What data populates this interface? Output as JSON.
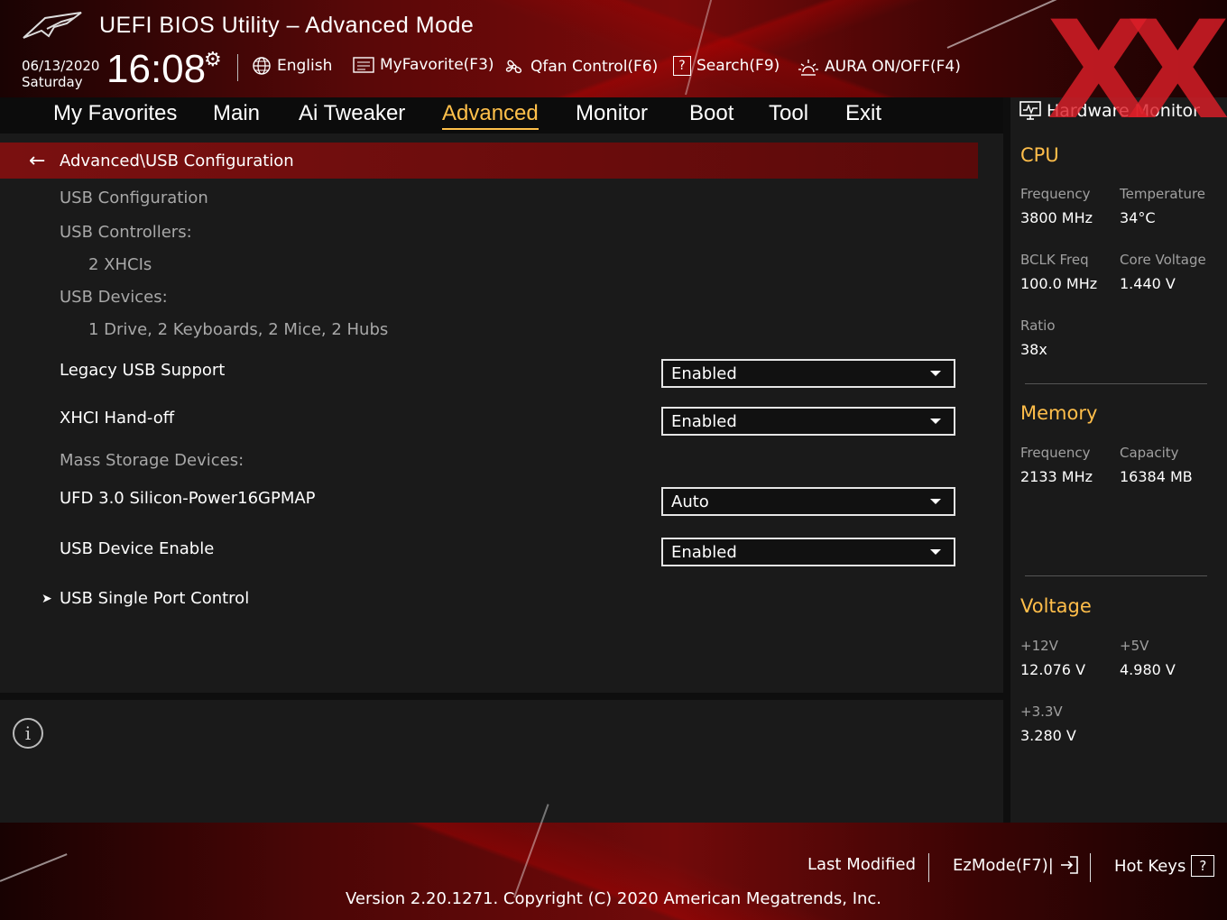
{
  "header": {
    "title": "UEFI BIOS Utility – Advanced Mode",
    "date": "06/13/2020",
    "day": "Saturday",
    "time": "16:08",
    "language": "English",
    "myfavorite": "MyFavorite(F3)",
    "qfan": "Qfan Control(F6)",
    "search": "Search(F9)",
    "aura": "AURA ON/OFF(F4)"
  },
  "tabs": [
    "My Favorites",
    "Main",
    "Ai Tweaker",
    "Advanced",
    "Monitor",
    "Boot",
    "Tool",
    "Exit"
  ],
  "active_tab": "Advanced",
  "breadcrumb": "Advanced\\USB Configuration",
  "main": {
    "usb_configuration": "USB Configuration",
    "usb_controllers_label": "USB Controllers:",
    "usb_controllers_value": "2 XHCIs",
    "usb_devices_label": "USB Devices:",
    "usb_devices_value": "1 Drive, 2 Keyboards, 2 Mice, 2 Hubs",
    "legacy_usb_label": "Legacy USB Support",
    "legacy_usb_value": "Enabled",
    "xhci_label": "XHCI Hand-off",
    "xhci_value": "Enabled",
    "mass_storage_label": "Mass Storage Devices:",
    "ufd_label": "UFD 3.0 Silicon-Power16GPMAP",
    "ufd_value": "Auto",
    "usb_device_enable_label": "USB Device Enable",
    "usb_device_enable_value": "Enabled",
    "usb_single_port_label": "USB Single Port Control"
  },
  "hwmon": {
    "title": "Hardware Monitor",
    "cpu": {
      "section": "CPU",
      "frequency_label": "Frequency",
      "frequency_value": "3800 MHz",
      "temperature_label": "Temperature",
      "temperature_value": "34°C",
      "bclk_label": "BCLK Freq",
      "bclk_value": "100.0 MHz",
      "core_voltage_label": "Core Voltage",
      "core_voltage_value": "1.440 V",
      "ratio_label": "Ratio",
      "ratio_value": "38x"
    },
    "memory": {
      "section": "Memory",
      "frequency_label": "Frequency",
      "frequency_value": "2133 MHz",
      "capacity_label": "Capacity",
      "capacity_value": "16384 MB"
    },
    "voltage": {
      "section": "Voltage",
      "v12_label": "+12V",
      "v12_value": "12.076 V",
      "v5_label": "+5V",
      "v5_value": "4.980 V",
      "v33_label": "+3.3V",
      "v33_value": "3.280 V"
    }
  },
  "footer": {
    "last_modified": "Last Modified",
    "ezmode": "EzMode(F7)|",
    "hotkeys": "Hot Keys",
    "hotkeys_glyph": "?",
    "version": "Version 2.20.1271. Copyright (C) 2020 American Megatrends, Inc."
  },
  "watermark": "XX",
  "colors": {
    "accent": "#ffc04a",
    "breadcrumb_bg": "#7a1010",
    "panel_bg": "#1a1a1a"
  }
}
